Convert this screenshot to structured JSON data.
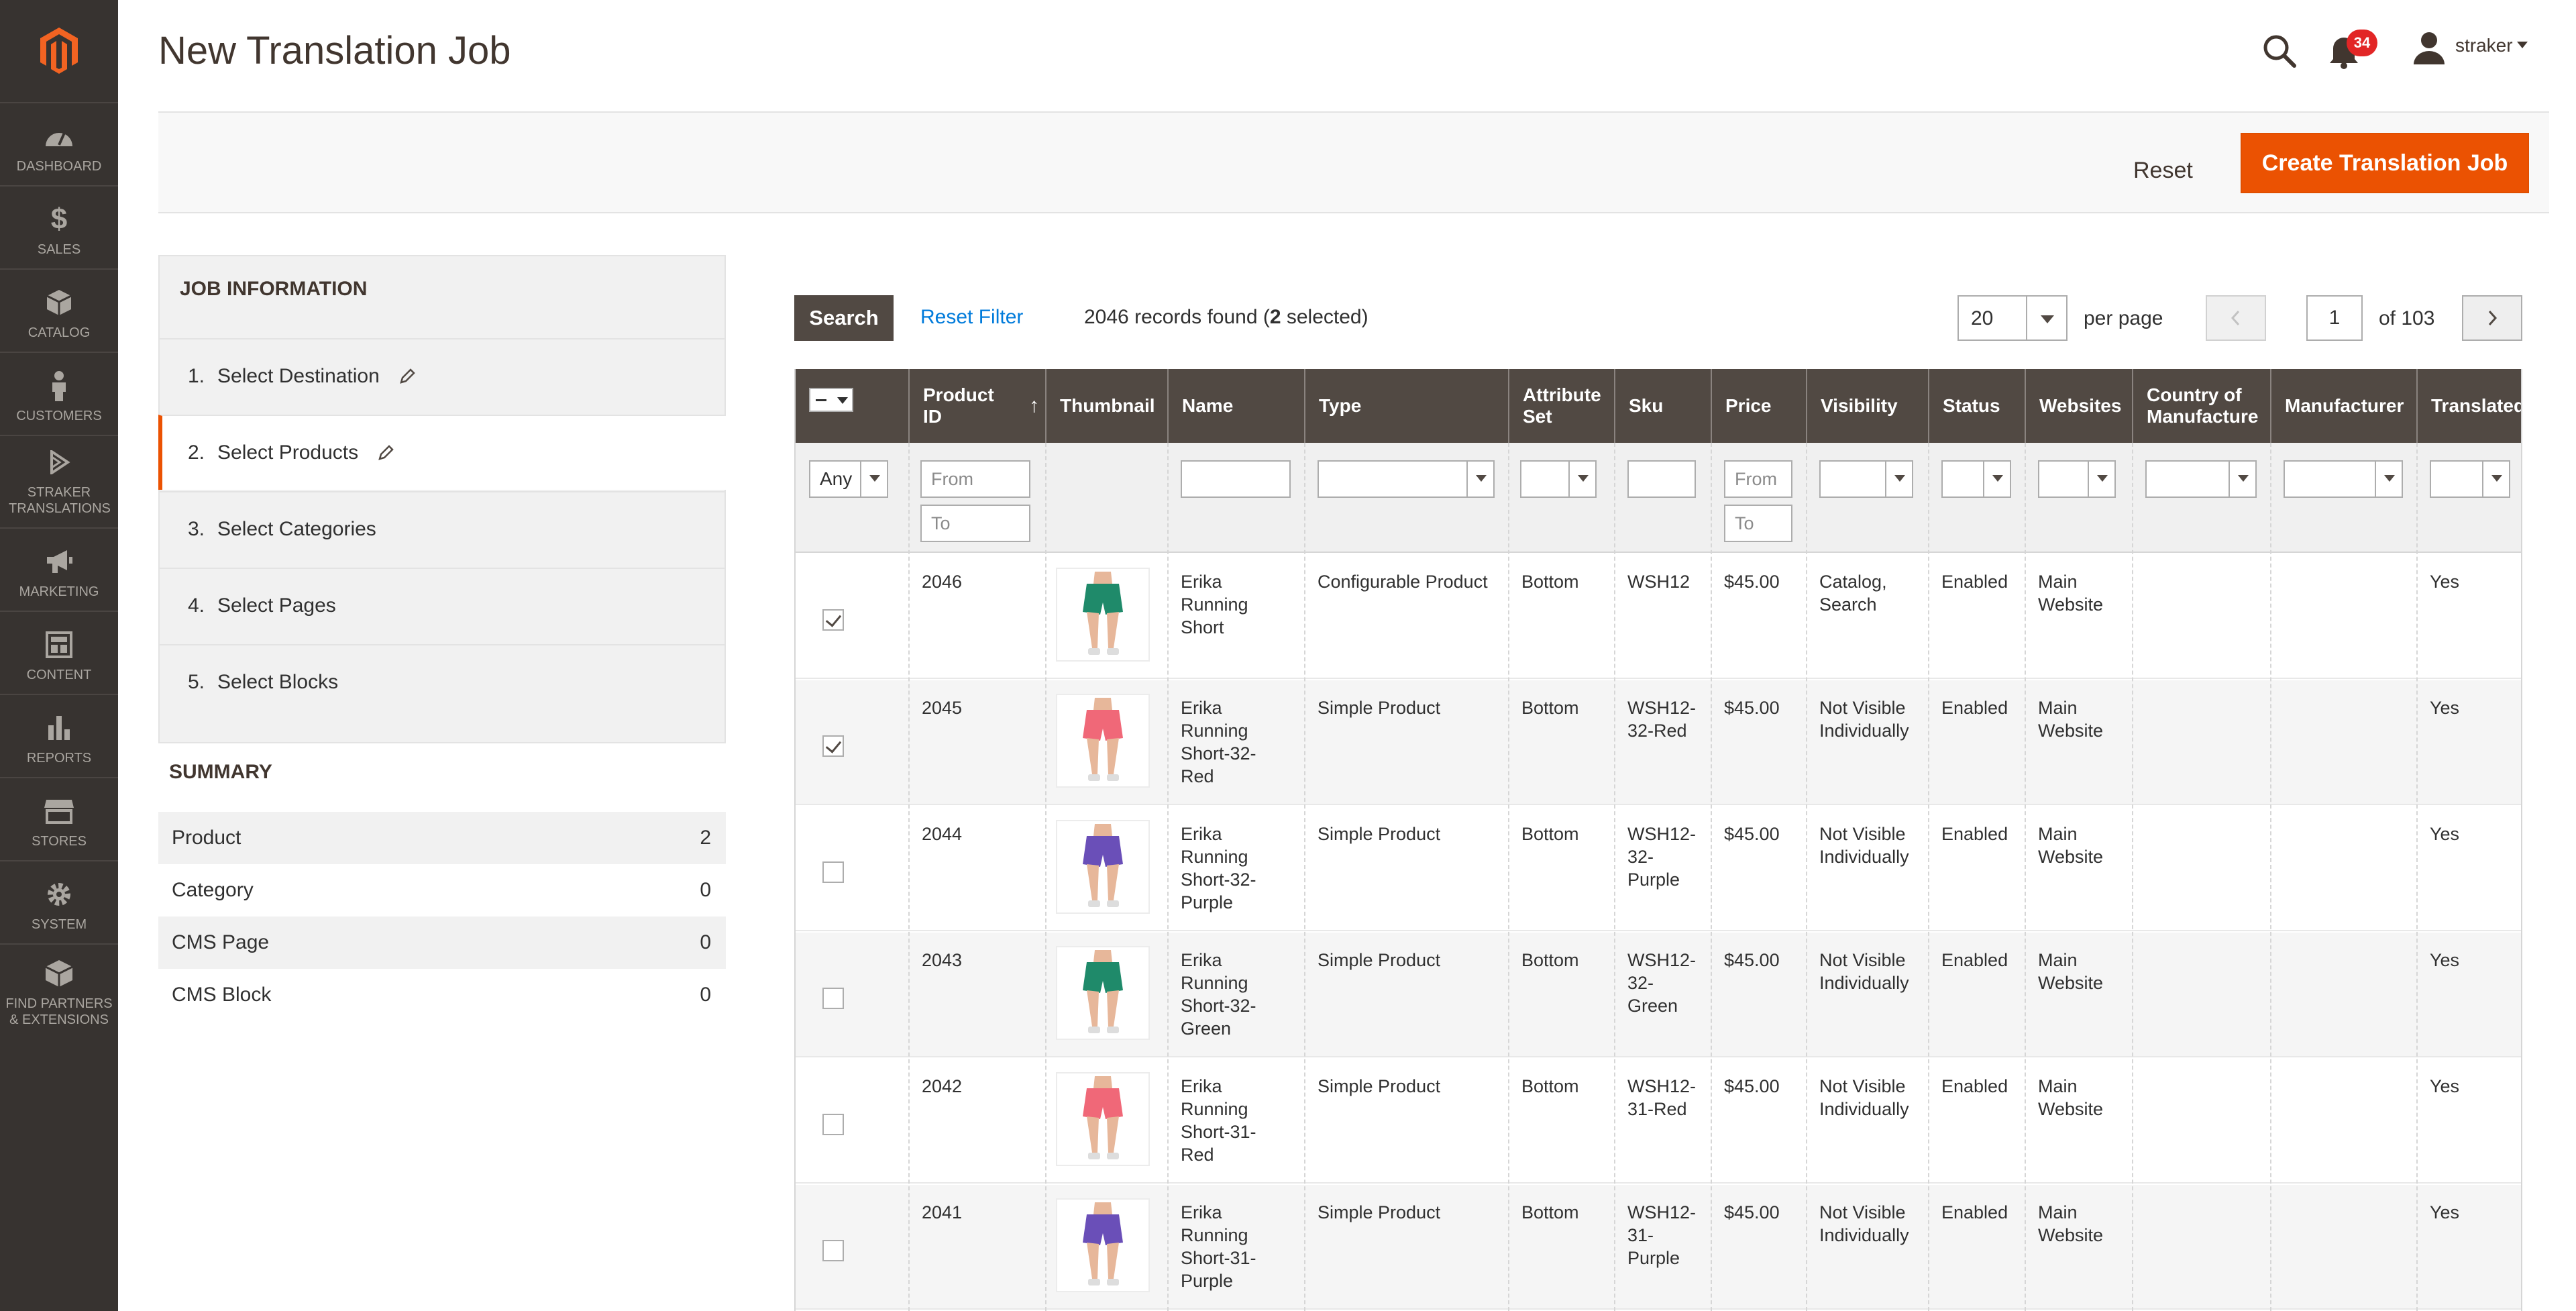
{
  "page": {
    "title": "New Translation Job"
  },
  "nav": {
    "items": [
      {
        "label": "DASHBOARD",
        "icon": "dashboard-icon"
      },
      {
        "label": "$",
        "icon": "dollar-icon"
      },
      {
        "label": "SALES",
        "icon": "dollar-icon"
      },
      {
        "label": "CATALOG",
        "icon": "cube-icon"
      },
      {
        "label": "CUSTOMERS",
        "icon": "person-icon"
      },
      {
        "label": "STRAKER TRANSLATIONS",
        "icon": "straker-icon"
      },
      {
        "label": "MARKETING",
        "icon": "megaphone-icon"
      },
      {
        "label": "CONTENT",
        "icon": "layout-icon"
      },
      {
        "label": "REPORTS",
        "icon": "bar-chart-icon"
      },
      {
        "label": "STORES",
        "icon": "store-icon"
      },
      {
        "label": "SYSTEM",
        "icon": "gear-icon"
      },
      {
        "label": "FIND PARTNERS & EXTENSIONS",
        "icon": "box-icon"
      }
    ]
  },
  "header": {
    "notifications": "34",
    "user": "straker"
  },
  "actions": {
    "reset": "Reset",
    "create": "Create Translation Job"
  },
  "job": {
    "title": "JOB INFORMATION",
    "steps": [
      {
        "num": "1.",
        "label": "Select Destination"
      },
      {
        "num": "2.",
        "label": "Select Products"
      },
      {
        "num": "3.",
        "label": "Select Categories"
      },
      {
        "num": "4.",
        "label": "Select Pages"
      },
      {
        "num": "5.",
        "label": "Select Blocks"
      }
    ]
  },
  "summary": {
    "title": "SUMMARY",
    "rows": [
      {
        "label": "Product",
        "value": "2"
      },
      {
        "label": "Category",
        "value": "0"
      },
      {
        "label": "CMS Page",
        "value": "0"
      },
      {
        "label": "CMS Block",
        "value": "0"
      }
    ]
  },
  "toolbar": {
    "search": "Search",
    "reset_filter": "Reset Filter",
    "records_prefix": "2046 records found (",
    "records_selected": "2",
    "records_suffix": " selected)",
    "per_page_value": "20",
    "per_page_label": "per page",
    "page": "1",
    "of_pages": "of 103"
  },
  "grid": {
    "columns": {
      "product_id": "Product ID",
      "thumbnail": "Thumbnail",
      "name": "Name",
      "type": "Type",
      "attribute_set": "Attribute Set",
      "sku": "Sku",
      "price": "Price",
      "visibility": "Visibility",
      "status": "Status",
      "websites": "Websites",
      "country": "Country of Manufacture",
      "manufacturer": "Manufacturer",
      "translated": "Translated"
    },
    "filters": {
      "any": "Any",
      "from": "From",
      "to": "To"
    },
    "rows": [
      {
        "checked": true,
        "id": "2046",
        "color": "#1f8a6a",
        "name": "Erika Running Short",
        "type": "Configurable Product",
        "attr": "Bottom",
        "sku": "WSH12",
        "price": "$45.00",
        "visibility": "Catalog, Search",
        "status": "Enabled",
        "websites": "Main Website",
        "translated": "Yes"
      },
      {
        "checked": true,
        "id": "2045",
        "color": "#f06878",
        "name": "Erika Running Short-32-Red",
        "type": "Simple Product",
        "attr": "Bottom",
        "sku": "WSH12-32-Red",
        "price": "$45.00",
        "visibility": "Not Visible Individually",
        "status": "Enabled",
        "websites": "Main Website",
        "translated": "Yes"
      },
      {
        "checked": false,
        "id": "2044",
        "color": "#6a4fb8",
        "name": "Erika Running Short-32-Purple",
        "type": "Simple Product",
        "attr": "Bottom",
        "sku": "WSH12-32-Purple",
        "price": "$45.00",
        "visibility": "Not Visible Individually",
        "status": "Enabled",
        "websites": "Main Website",
        "translated": "Yes"
      },
      {
        "checked": false,
        "id": "2043",
        "color": "#1f8a6a",
        "name": "Erika Running Short-32-Green",
        "type": "Simple Product",
        "attr": "Bottom",
        "sku": "WSH12-32-Green",
        "price": "$45.00",
        "visibility": "Not Visible Individually",
        "status": "Enabled",
        "websites": "Main Website",
        "translated": "Yes"
      },
      {
        "checked": false,
        "id": "2042",
        "color": "#f06878",
        "name": "Erika Running Short-31-Red",
        "type": "Simple Product",
        "attr": "Bottom",
        "sku": "WSH12-31-Red",
        "price": "$45.00",
        "visibility": "Not Visible Individually",
        "status": "Enabled",
        "websites": "Main Website",
        "translated": "Yes"
      },
      {
        "checked": false,
        "id": "2041",
        "color": "#6a4fb8",
        "name": "Erika Running Short-31-Purple",
        "type": "Simple Product",
        "attr": "Bottom",
        "sku": "WSH12-31-Purple",
        "price": "$45.00",
        "visibility": "Not Visible Individually",
        "status": "Enabled",
        "websites": "Main Website",
        "translated": "Yes"
      }
    ]
  },
  "colors": {
    "accent": "#eb5202",
    "nav_bg": "#373330",
    "grid_head": "#514943",
    "link": "#007bdb"
  }
}
